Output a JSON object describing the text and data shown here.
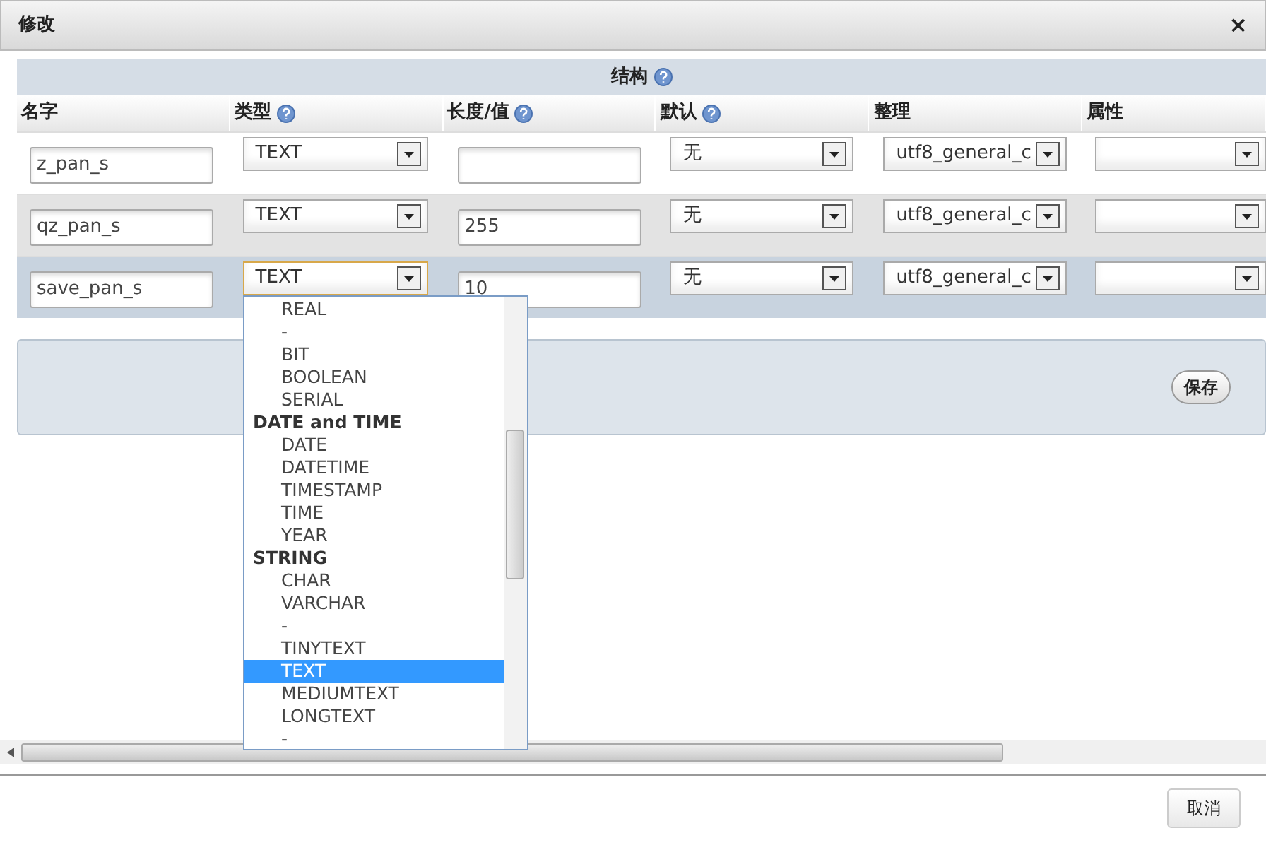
{
  "window": {
    "title": "修改",
    "close": "×"
  },
  "structure_header": "结构",
  "columns": [
    {
      "label": "名字",
      "help": false
    },
    {
      "label": "类型",
      "help": true
    },
    {
      "label": "长度/值",
      "help": true
    },
    {
      "label": "默认",
      "help": true
    },
    {
      "label": "整理",
      "help": false
    },
    {
      "label": "属性",
      "help": false
    }
  ],
  "rows": [
    {
      "name": "z_pan_s",
      "type": "TEXT",
      "length": "",
      "default": "无",
      "collation": "utf8_general_c",
      "attribute": "",
      "selected": false
    },
    {
      "name": "qz_pan_s",
      "type": "TEXT",
      "length": "255",
      "default": "无",
      "collation": "utf8_general_c",
      "attribute": "",
      "selected": false
    },
    {
      "name": "save_pan_s",
      "type": "TEXT",
      "length": "10",
      "default": "无",
      "collation": "utf8_general_c",
      "attribute": "",
      "selected": true
    }
  ],
  "dropdown": [
    {
      "label": "REAL",
      "kind": "option",
      "selected": false
    },
    {
      "label": "-",
      "kind": "option",
      "selected": false
    },
    {
      "label": "BIT",
      "kind": "option",
      "selected": false
    },
    {
      "label": "BOOLEAN",
      "kind": "option",
      "selected": false
    },
    {
      "label": "SERIAL",
      "kind": "option",
      "selected": false
    },
    {
      "label": "DATE and TIME",
      "kind": "group",
      "selected": false
    },
    {
      "label": "DATE",
      "kind": "option",
      "selected": false
    },
    {
      "label": "DATETIME",
      "kind": "option",
      "selected": false
    },
    {
      "label": "TIMESTAMP",
      "kind": "option",
      "selected": false
    },
    {
      "label": "TIME",
      "kind": "option",
      "selected": false
    },
    {
      "label": "YEAR",
      "kind": "option",
      "selected": false
    },
    {
      "label": "STRING",
      "kind": "group",
      "selected": false
    },
    {
      "label": "CHAR",
      "kind": "option",
      "selected": false
    },
    {
      "label": "VARCHAR",
      "kind": "option",
      "selected": false
    },
    {
      "label": "-",
      "kind": "option",
      "selected": false
    },
    {
      "label": "TINYTEXT",
      "kind": "option",
      "selected": false
    },
    {
      "label": "TEXT",
      "kind": "option",
      "selected": true
    },
    {
      "label": "MEDIUMTEXT",
      "kind": "option",
      "selected": false
    },
    {
      "label": "LONGTEXT",
      "kind": "option",
      "selected": false
    },
    {
      "label": "-",
      "kind": "option",
      "selected": false
    }
  ],
  "save_button": "保存",
  "cancel_button": "取消"
}
